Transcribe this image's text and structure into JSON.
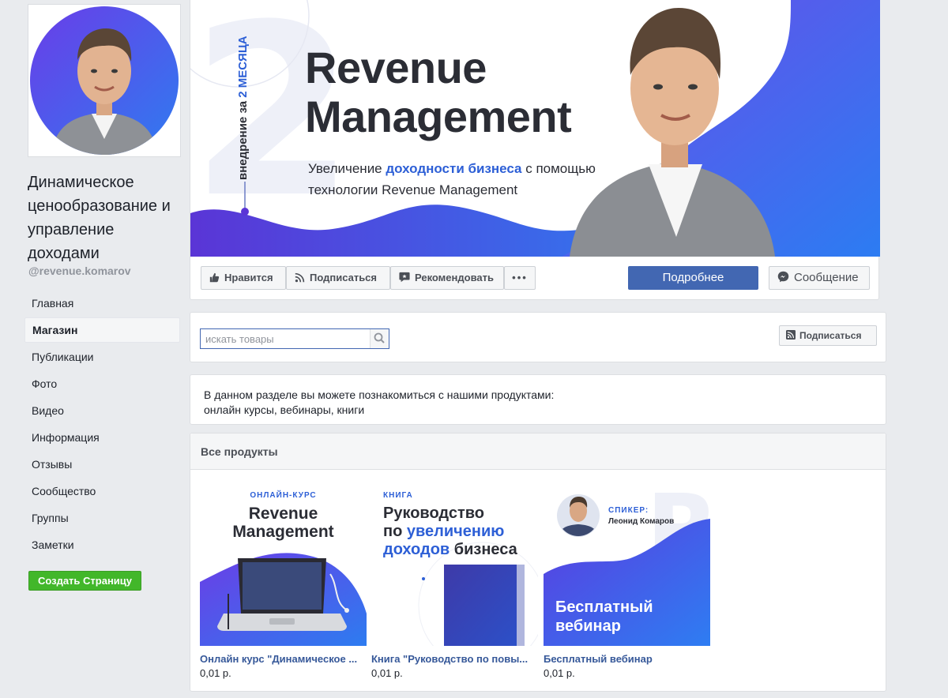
{
  "page": {
    "name": "Динамическое ценообразование и управление доходами",
    "handle": "@revenue.komarov"
  },
  "nav": {
    "items": [
      {
        "label": "Главная"
      },
      {
        "label": "Магазин"
      },
      {
        "label": "Публикации"
      },
      {
        "label": "Фото"
      },
      {
        "label": "Видео"
      },
      {
        "label": "Информация"
      },
      {
        "label": "Отзывы"
      },
      {
        "label": "Сообщество"
      },
      {
        "label": "Группы"
      },
      {
        "label": "Заметки"
      }
    ],
    "active": "Магазин",
    "create_page": "Создать Страницу"
  },
  "cover": {
    "title_line1": "Revenue",
    "title_line2": "Management",
    "vertical_text": "внедрение за",
    "vertical_accent": "2 МЕСЯЦА",
    "big_digit": "2",
    "subtitle_a": "Увеличение ",
    "subtitle_accent": "доходности бизнеса",
    "subtitle_b": " с помощью",
    "subtitle_line2": "технологии Revenue Management"
  },
  "actions": {
    "like": "Нравится",
    "follow": "Подписаться",
    "recommend": "Рекомендовать",
    "more": "•••",
    "details": "Подробнее",
    "message": "Сообщение"
  },
  "shop": {
    "search_placeholder": "искать товары",
    "subscribe": "Подписаться",
    "description_line1": "В данном разделе вы можете познакомиться с нашими продуктами:",
    "description_line2": "онлайн курсы, вебинары, книги",
    "section_title": "Все продукты",
    "products": [
      {
        "name": "Онлайн курс \"Динамическое ...",
        "price": "0,01 р.",
        "thumb_tag": "ОНЛАЙН-КУРС",
        "thumb_title_1": "Revenue",
        "thumb_title_2": "Management"
      },
      {
        "name": "Книга \"Руководство по повы...",
        "price": "0,01 р.",
        "thumb_tag": "КНИГА",
        "thumb_title_1": "Руководство",
        "thumb_title_2a": "по ",
        "thumb_title_2b": "увеличению",
        "thumb_title_3a": "доходов",
        "thumb_title_3b": " бизнеса"
      },
      {
        "name": "Бесплатный вебинар",
        "price": "0,01 р.",
        "thumb_tag": "СПИКЕР:",
        "thumb_speaker": "Леонид Комаров",
        "thumb_title_1": "Бесплатный",
        "thumb_title_2": "вебинар",
        "thumb_letter": "R"
      }
    ]
  },
  "colors": {
    "brand_blue": "#4267b2",
    "link_blue": "#365899",
    "accent_blue": "#2d5fd6",
    "purple": "#5b3fd9",
    "green": "#42b72a"
  }
}
